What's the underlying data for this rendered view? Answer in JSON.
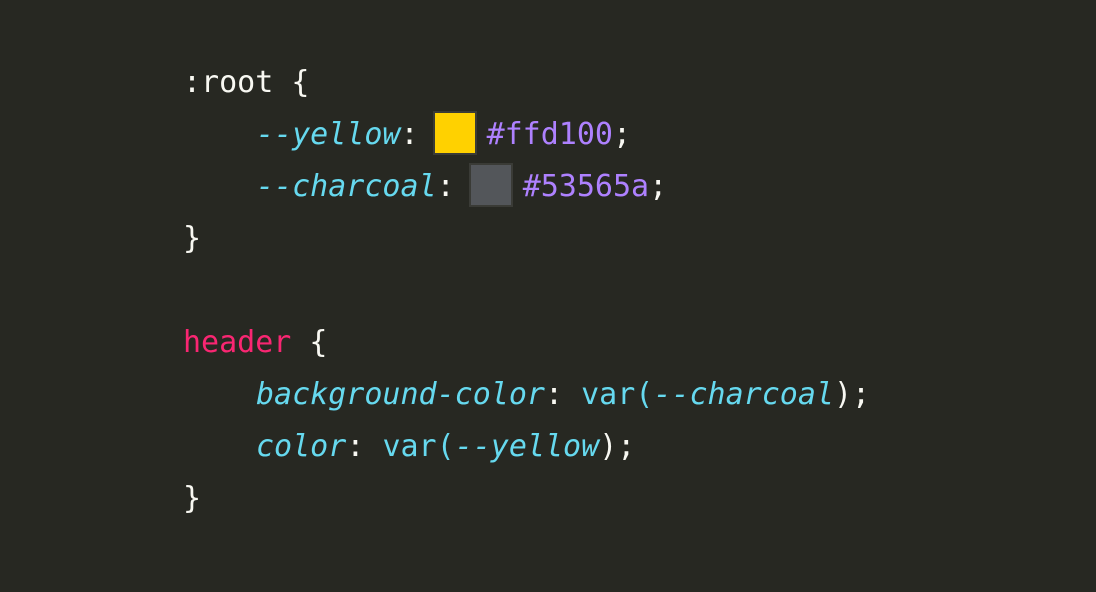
{
  "colors": {
    "background": "#272822",
    "default_text": "#f8f8f2",
    "property": "#66d9ef",
    "tag_selector": "#f92672",
    "hex_value": "#ae81ff",
    "swatch_yellow": "#ffd100",
    "swatch_charcoal": "#53565a"
  },
  "code": {
    "block1": {
      "selector": ":root",
      "open": " {",
      "close": "}",
      "declarations": [
        {
          "property": "--yellow",
          "colon": ":",
          "value": "#ffd100",
          "semicolon": ";"
        },
        {
          "property": "--charcoal",
          "colon": ":",
          "value": "#53565a",
          "semicolon": ";"
        }
      ]
    },
    "block2": {
      "selector": "header",
      "open": " {",
      "close": "}",
      "declarations": [
        {
          "property": "background-color",
          "colon": ": ",
          "func": "var(",
          "var_name": "--charcoal",
          "func_close": ")",
          "semicolon": ";"
        },
        {
          "property": "color",
          "colon": ": ",
          "func": "var(",
          "var_name": "--yellow",
          "func_close": ")",
          "semicolon": ";"
        }
      ]
    }
  }
}
